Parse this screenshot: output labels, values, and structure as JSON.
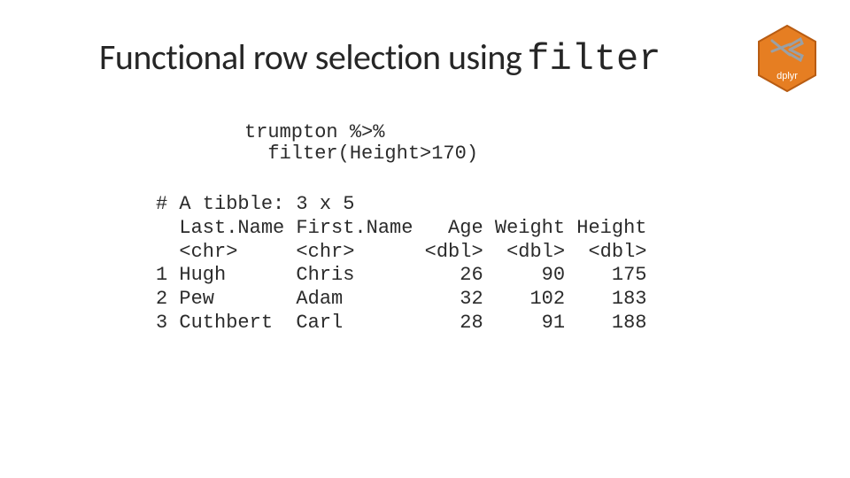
{
  "title": {
    "plain": "Functional row selection using",
    "code": "filter"
  },
  "badge": {
    "label": "dplyr",
    "bg": "#e67e22",
    "pliers": "#b8c0c6"
  },
  "code": {
    "line1": "trumpton %>%",
    "line2": "  filter(Height>170)"
  },
  "tibble": {
    "header": "# A tibble: 3 x 5",
    "cols": "  Last.Name First.Name   Age Weight Height",
    "types": "  <chr>     <chr>      <dbl>  <dbl>  <dbl>",
    "r1": "1 Hugh      Chris         26     90    175",
    "r2": "2 Pew       Adam          32    102    183",
    "r3": "3 Cuthbert  Carl          28     91    188"
  }
}
